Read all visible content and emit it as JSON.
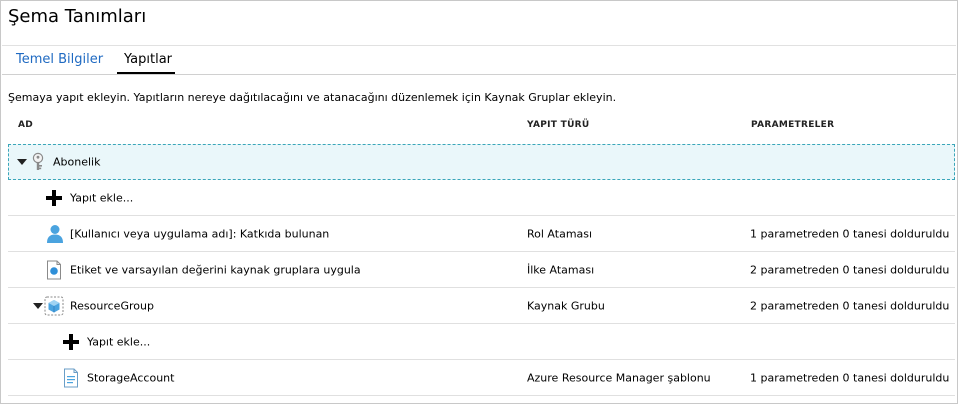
{
  "page": {
    "title": "Şema Tanımları"
  },
  "tabs": [
    {
      "label": "Temel Bilgiler"
    },
    {
      "label": "Yapıtlar"
    }
  ],
  "description": "Şemaya yapıt ekleyin. Yapıtların nereye dağıtılacağını ve atanacağını düzenlemek için Kaynak Gruplar ekleyin.",
  "columns": {
    "name": "AD",
    "type": "YAPIT TÜRÜ",
    "params": "PARAMETRELER"
  },
  "rows": [
    {
      "name": "Abonelik",
      "icon": "key-icon",
      "type": "",
      "params": ""
    },
    {
      "name": "Yapıt ekle...",
      "icon": "plus-icon",
      "type": "",
      "params": ""
    },
    {
      "name": "[Kullanıcı veya uygulama adı]: Katkıda bulunan",
      "icon": "user-icon",
      "type": "Rol Ataması",
      "params": "1 parametreden 0 tanesi dolduruldu"
    },
    {
      "name": "Etiket ve varsayılan değerini kaynak gruplara uygula",
      "icon": "policy-icon",
      "type": "İlke Ataması",
      "params": "2 parametreden 0 tanesi dolduruldu"
    },
    {
      "name": "ResourceGroup",
      "icon": "resource-group-icon",
      "type": "Kaynak Grubu",
      "params": "2 parametreden 0 tanesi dolduruldu"
    },
    {
      "name": "Yapıt ekle...",
      "icon": "plus-icon",
      "type": "",
      "params": ""
    },
    {
      "name": "StorageAccount",
      "icon": "template-icon",
      "type": "Azure Resource Manager şablonu",
      "params": "1 parametreden 0 tanesi dolduruldu"
    }
  ],
  "colors": {
    "link": "#1f6ac2",
    "selection_border": "#3aa6b9",
    "selection_fill": "#eaf7fa",
    "icon_blue": "#4aa3df"
  }
}
